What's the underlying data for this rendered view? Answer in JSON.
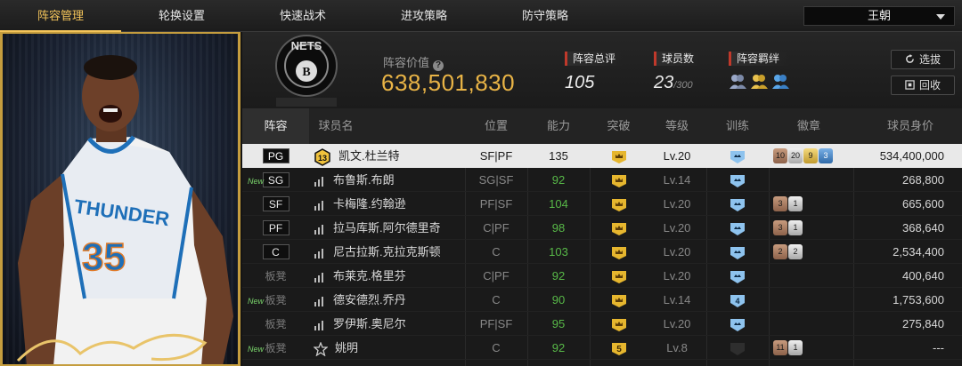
{
  "tabs": [
    {
      "label": "阵容管理",
      "active": true
    },
    {
      "label": "轮换设置",
      "active": false
    },
    {
      "label": "快速战术",
      "active": false
    },
    {
      "label": "进攻策略",
      "active": false
    },
    {
      "label": "防守策略",
      "active": false
    }
  ],
  "team_select": {
    "value": "王朝"
  },
  "header": {
    "lineup_value_label": "阵容价值",
    "lineup_value": "638,501,830",
    "rating_label": "阵容总评",
    "rating": "105",
    "players_label": "球员数",
    "players_count": "23",
    "players_max": "/300",
    "bond_label": "阵容羁绊",
    "select_button": "选拔",
    "recycle_button": "回收"
  },
  "columns": [
    "阵容",
    "球员名",
    "位置",
    "能力",
    "突破",
    "等级",
    "训练",
    "徽章",
    "球员身价"
  ],
  "rows": [
    {
      "slot": "PG",
      "bench": false,
      "new": false,
      "selected": true,
      "icon": "13",
      "name": "凯文.杜兰特",
      "position": "SF|PF",
      "ability": "135",
      "break": "crown",
      "level": "Lv.20",
      "train": "",
      "badges": [
        [
          "bronze",
          "10"
        ],
        [
          "silver",
          "20"
        ],
        [
          "gold",
          "9"
        ],
        [
          "blue",
          "3"
        ]
      ],
      "value": "534,400,000"
    },
    {
      "slot": "SG",
      "bench": false,
      "new": true,
      "selected": false,
      "icon": "bars",
      "name": "布鲁斯.布朗",
      "position": "SG|SF",
      "ability": "92",
      "break": "crown",
      "level": "Lv.14",
      "train": "",
      "badges": [],
      "value": "268,800"
    },
    {
      "slot": "SF",
      "bench": false,
      "new": false,
      "selected": false,
      "icon": "bars",
      "name": "卡梅隆.约翰逊",
      "position": "PF|SF",
      "ability": "104",
      "break": "crown",
      "level": "Lv.20",
      "train": "",
      "badges": [
        [
          "bronze",
          "3"
        ],
        [
          "silver",
          "1"
        ]
      ],
      "value": "665,600"
    },
    {
      "slot": "PF",
      "bench": false,
      "new": false,
      "selected": false,
      "icon": "bars",
      "name": "拉马库斯.阿尔德里奇",
      "position": "C|PF",
      "ability": "98",
      "break": "crown",
      "level": "Lv.20",
      "train": "",
      "badges": [
        [
          "bronze",
          "3"
        ],
        [
          "silver",
          "1"
        ]
      ],
      "value": "368,640"
    },
    {
      "slot": "C",
      "bench": false,
      "new": false,
      "selected": false,
      "icon": "bars",
      "name": "尼古拉斯.克拉克斯顿",
      "position": "C",
      "ability": "103",
      "break": "crown",
      "level": "Lv.20",
      "train": "",
      "badges": [
        [
          "bronze",
          "2"
        ],
        [
          "silver",
          "2"
        ]
      ],
      "value": "2,534,400"
    },
    {
      "slot": "板凳",
      "bench": true,
      "new": false,
      "selected": false,
      "icon": "bars",
      "name": "布莱克.格里芬",
      "position": "C|PF",
      "ability": "92",
      "break": "crown",
      "level": "Lv.20",
      "train": "",
      "badges": [],
      "value": "400,640"
    },
    {
      "slot": "板凳",
      "bench": true,
      "new": true,
      "selected": false,
      "icon": "bars",
      "name": "德安德烈.乔丹",
      "position": "C",
      "ability": "90",
      "break": "crown",
      "level": "Lv.14",
      "train": "4",
      "badges": [],
      "value": "1,753,600"
    },
    {
      "slot": "板凳",
      "bench": true,
      "new": false,
      "selected": false,
      "icon": "bars",
      "name": "罗伊斯.奥尼尔",
      "position": "PF|SF",
      "ability": "95",
      "break": "crown",
      "level": "Lv.20",
      "train": "",
      "badges": [],
      "value": "275,840"
    },
    {
      "slot": "板凳",
      "bench": true,
      "new": true,
      "selected": false,
      "icon": "star",
      "name": "姚明",
      "position": "C",
      "ability": "92",
      "break": "5",
      "level": "Lv.8",
      "train": "",
      "badges": [
        [
          "bronze",
          "11"
        ],
        [
          "silver",
          "1"
        ]
      ],
      "value": "---"
    }
  ],
  "new_label": "New",
  "colors": {
    "accent": "#f3c45a",
    "gold_value": "#e9b446",
    "green_ability": "#58b948"
  }
}
